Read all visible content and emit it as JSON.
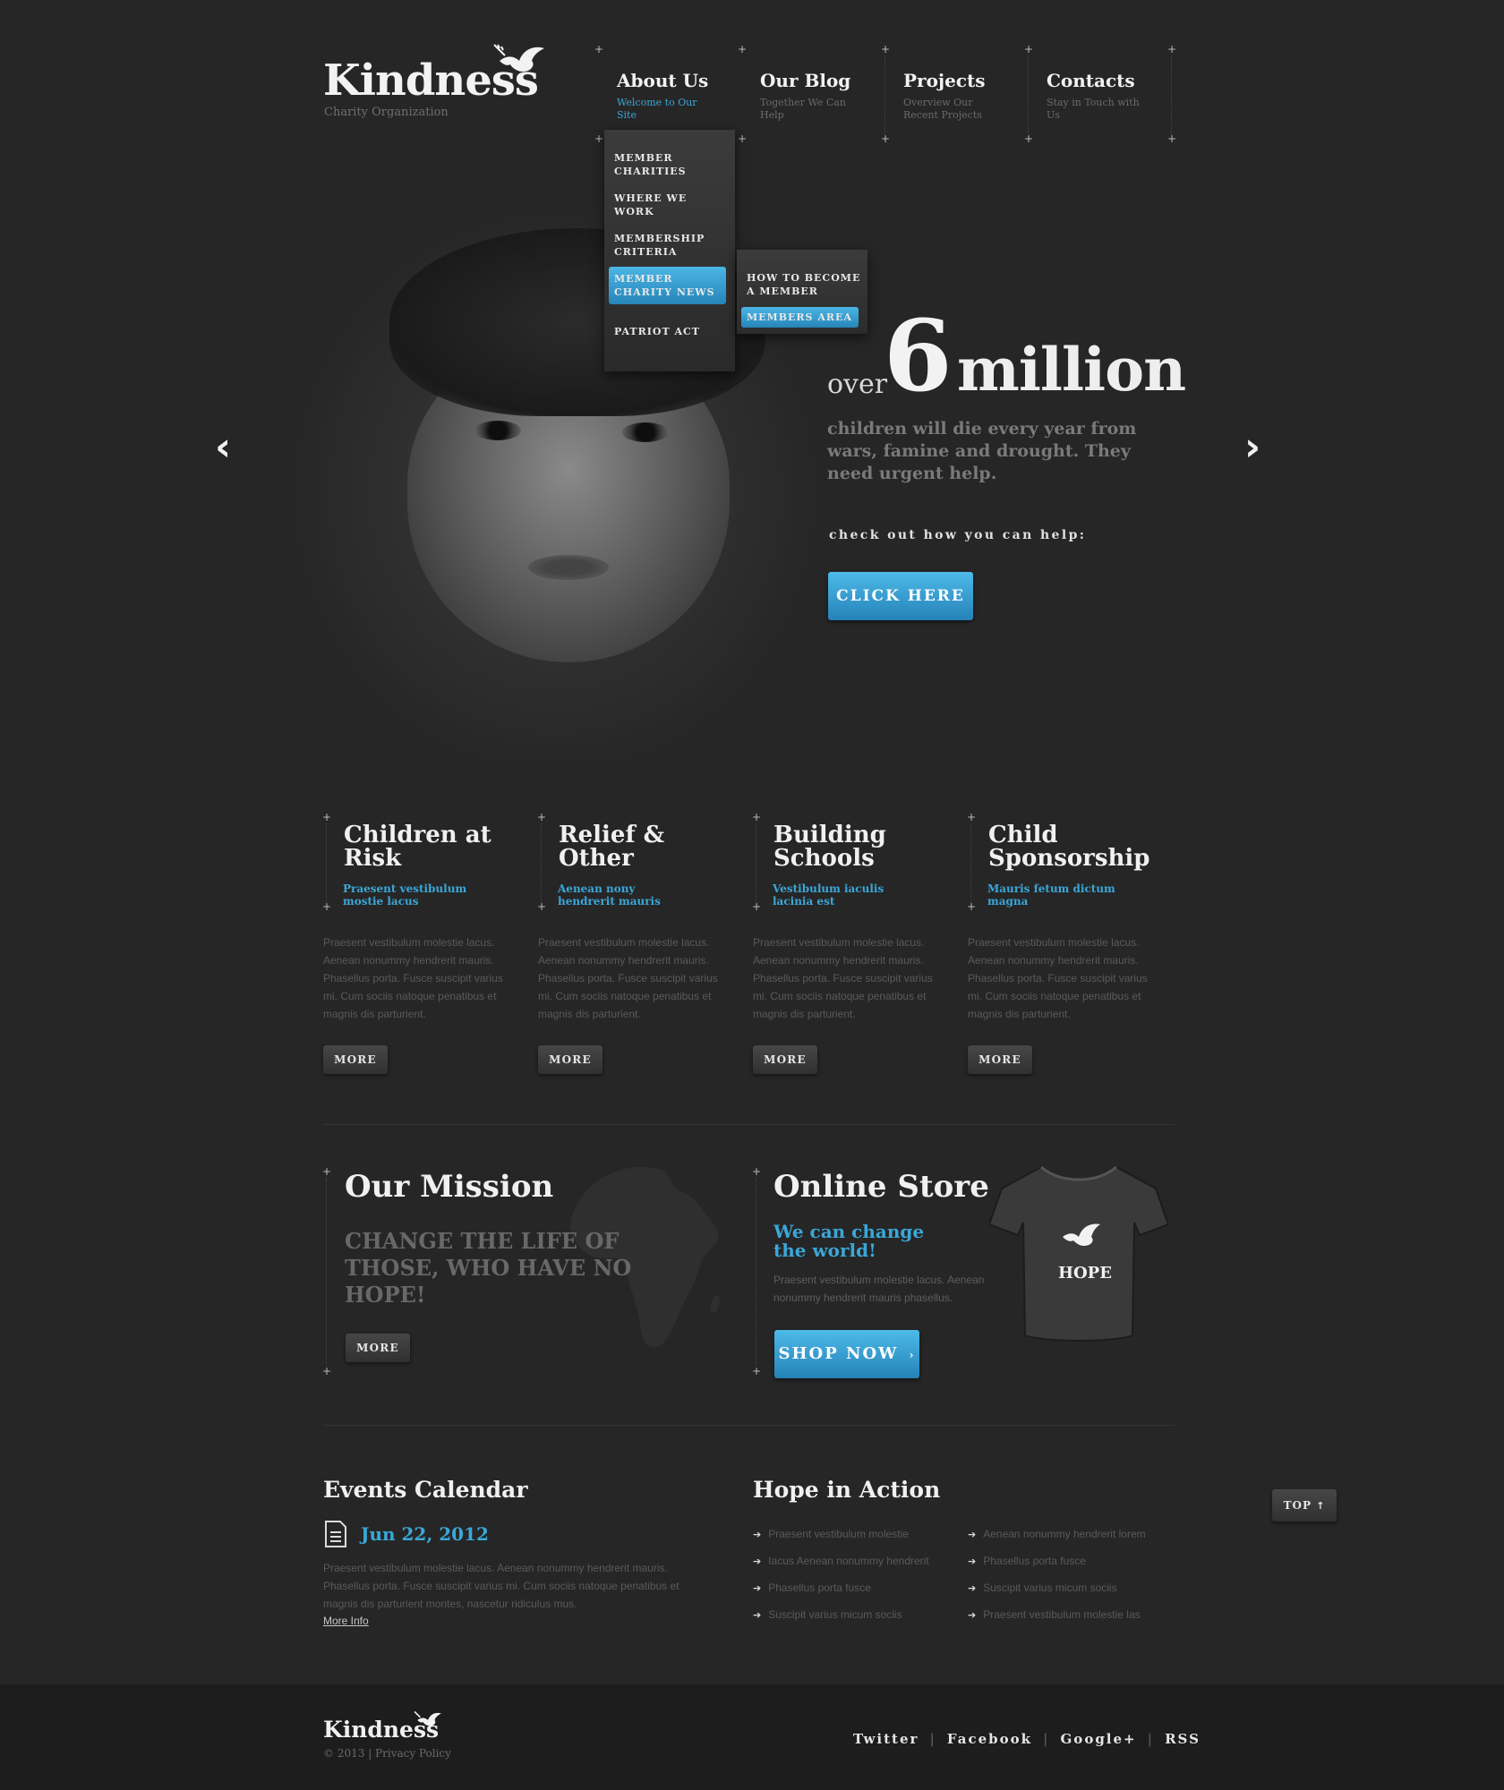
{
  "logo": {
    "title": "Kindness",
    "subtitle": "Charity Organization"
  },
  "nav": [
    {
      "label": "About Us",
      "sub": "Welcome to Our Site"
    },
    {
      "label": "Our Blog",
      "sub": "Together We Can Help"
    },
    {
      "label": "Projects",
      "sub": "Overview Our Recent Projects"
    },
    {
      "label": "Contacts",
      "sub": "Stay in Touch with Us"
    }
  ],
  "dropdown": {
    "items": [
      "Member Charities",
      "Where We Work",
      "Membership Criteria",
      "Member Charity News",
      "Patriot Act"
    ],
    "submenu": [
      "How to Become a Member",
      "Members Area"
    ]
  },
  "hero": {
    "over": "over",
    "number": "6",
    "unit": "million",
    "description": "children will die every year from wars, famine and drought. They need urgent help.",
    "check": "check out how you can help:",
    "button": "CLICK HERE"
  },
  "features": [
    {
      "title": "Children at Risk",
      "sub": "Praesent vestibulum mostie lacus",
      "body": "Praesent vestibulum molestie lacus. Aenean nonummy hendrerit mauris. Phasellus porta. Fusce suscipit varius mi. Cum sociis natoque penatibus et magnis dis parturient.",
      "more": "MORE"
    },
    {
      "title": "Relief & Other",
      "sub": "Aenean nony hendrerit mauris",
      "body": "Praesent vestibulum molestie lacus. Aenean nonummy hendrerit mauris. Phasellus porta. Fusce suscipit varius mi. Cum sociis natoque penatibus et magnis dis parturient.",
      "more": "MORE"
    },
    {
      "title": "Building Schools",
      "sub": "Vestibulum iaculis lacinia est",
      "body": "Praesent vestibulum molestie lacus. Aenean nonummy hendrerit mauris. Phasellus porta. Fusce suscipit varius mi. Cum sociis natoque penatibus et magnis dis parturient.",
      "more": "MORE"
    },
    {
      "title": "Child Sponsorship",
      "sub": "Mauris fetum dictum magna",
      "body": "Praesent vestibulum molestie lacus. Aenean nonummy hendrerit mauris. Phasellus porta. Fusce suscipit varius mi. Cum sociis natoque penatibus et magnis dis parturient.",
      "more": "MORE"
    }
  ],
  "mission": {
    "title": "Our Mission",
    "text": "Change the life of those, who have no hope!",
    "more": "MORE"
  },
  "store": {
    "title": "Online Store",
    "sub": "We can change the world!",
    "body": "Praesent vestibulum molestie lacus. Aenean nonummy hendrerit mauris phasellus.",
    "button": "SHOP NOW",
    "shirt_text": "HOPE"
  },
  "events": {
    "title": "Events Calendar",
    "date": "Jun 22, 2012",
    "body": "Praesent vestibulum molestie lacus. Aenean nonummy hendrerit mauris. Phasellus porta. Fusce suscipit varius mi. Cum sociis natoque penatibus et magnis dis parturient montes, nascetur ridiculus mus.",
    "more": "More Info"
  },
  "hope": {
    "title": "Hope in Action",
    "col1": [
      "Praesent vestibulum molestie",
      "Iacus Aenean nonummy hendrerit",
      "Phasellus porta fusce",
      "Suscipit varius micum sociis"
    ],
    "col2": [
      "Aenean nonummy hendrerit lorem",
      "Phasellus porta fusce",
      "Suscipit varius micum sociis",
      "Praesent vestibulum molestie las"
    ]
  },
  "top_button": "TOP",
  "footer": {
    "logo": "Kindness",
    "copyright": "© 2013",
    "privacy": "Privacy Policy",
    "links": [
      "Twitter",
      "Facebook",
      "Google+",
      "RSS"
    ]
  },
  "colors": {
    "accent": "#3aa7d8",
    "background": "#262626",
    "footer": "#1d1d1d"
  }
}
